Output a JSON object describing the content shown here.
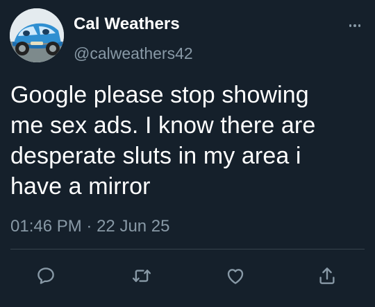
{
  "user": {
    "display_name": "Cal Weathers",
    "handle": "@calweathers42"
  },
  "tweet": {
    "text": "Google please stop showing\nme sex ads. I know there are\ndesperate sluts in my area i\nhave a mirror",
    "time": "01:46 PM",
    "separator": "·",
    "date": "22 Jun 25"
  },
  "actions": {
    "reply_icon": "reply-icon",
    "retweet_icon": "retweet-icon",
    "like_icon": "heart-icon",
    "share_icon": "share-icon"
  },
  "colors": {
    "background": "#15202b",
    "primary_text": "#ffffff",
    "secondary_text": "#8899a6",
    "divider": "#38444d"
  }
}
